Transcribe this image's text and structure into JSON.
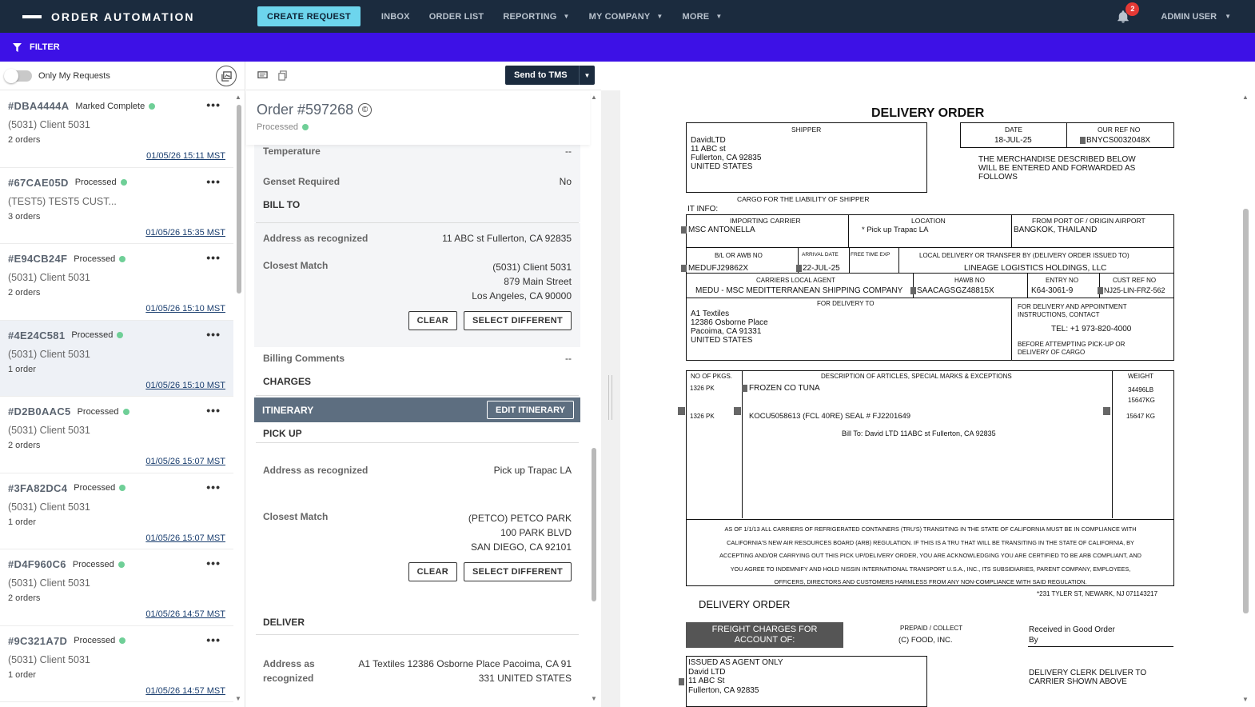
{
  "nav": {
    "brand": "ORDER AUTOMATION",
    "create_request": "CREATE REQUEST",
    "items": [
      "INBOX",
      "ORDER LIST",
      "REPORTING",
      "MY COMPANY",
      "MORE"
    ],
    "notification_count": "2",
    "user": "ADMIN USER"
  },
  "filter": {
    "label": "FILTER"
  },
  "left": {
    "only_my_requests": "Only My Requests",
    "requests": [
      {
        "id": "#DBA4444A",
        "status": "Marked Complete",
        "client": "(5031) Client 5031",
        "orders": "2 orders",
        "time": "01/05/26 15:11 MST"
      },
      {
        "id": "#67CAE05D",
        "status": "Processed",
        "client": "(TEST5) TEST5 CUST...",
        "orders": "3 orders",
        "time": "01/05/26 15:35 MST"
      },
      {
        "id": "#E94CB24F",
        "status": "Processed",
        "client": "(5031) Client 5031",
        "orders": "2 orders",
        "time": "01/05/26 15:10 MST"
      },
      {
        "id": "#4E24C581",
        "status": "Processed",
        "client": "(5031) Client 5031",
        "orders": "1 order",
        "time": "01/05/26 15:10 MST"
      },
      {
        "id": "#D2B0AAC5",
        "status": "Processed",
        "client": "(5031) Client 5031",
        "orders": "2 orders",
        "time": "01/05/26 15:07 MST"
      },
      {
        "id": "#3FA82DC4",
        "status": "Processed",
        "client": "(5031) Client 5031",
        "orders": "1 order",
        "time": "01/05/26 15:07 MST"
      },
      {
        "id": "#D4F960C6",
        "status": "Processed",
        "client": "(5031) Client 5031",
        "orders": "2 orders",
        "time": "01/05/26 14:57 MST"
      },
      {
        "id": "#9C321A7D",
        "status": "Processed",
        "client": "(5031) Client 5031",
        "orders": "1 order",
        "time": "01/05/26 14:57 MST"
      }
    ]
  },
  "mid": {
    "send_to_tms": "Send to TMS",
    "order_title": "Order #597268",
    "order_status": "Processed",
    "temperature_label": "Temperature",
    "temperature_value": "--",
    "genset_label": "Genset Required",
    "genset_value": "No",
    "bill_to_title": "BILL TO",
    "bill_addr_label": "Address as recognized",
    "bill_addr_value": "11 ABC st Fullerton, CA 92835",
    "bill_match_label": "Closest Match",
    "bill_match_lines": [
      "(5031) Client 5031",
      "879 Main Street",
      "Los Angeles, CA 90000"
    ],
    "clear": "CLEAR",
    "select_different": "SELECT DIFFERENT",
    "billing_comments_label": "Billing Comments",
    "billing_comments_value": "--",
    "charges_title": "CHARGES",
    "itinerary_title": "ITINERARY",
    "edit_itinerary": "EDIT ITINERARY",
    "pickup_title": "PICK UP",
    "pickup_addr_label": "Address as recognized",
    "pickup_addr_value": "Pick up Trapac LA",
    "pickup_match_label": "Closest Match",
    "pickup_match_lines": [
      "(PETCO) PETCO PARK",
      "100 PARK BLVD",
      "SAN DIEGO, CA 92101"
    ],
    "deliver_title": "DELIVER",
    "deliver_addr_label_1": "Address as",
    "deliver_addr_label_2": "recognized",
    "deliver_addr_line_1": "A1 Textiles 12386 Osborne Place Pacoima, CA 91",
    "deliver_addr_line_2": "331 UNITED STATES"
  },
  "doc": {
    "title": "DELIVERY ORDER",
    "shipper_cap": "SHIPPER",
    "shipper_lines": [
      "DavidLTD",
      "11 ABC st",
      "Fullerton, CA 92835",
      "UNITED STATES"
    ],
    "date_cap": "DATE",
    "date_val": "18-JUL-25",
    "ref_cap": "OUR REF NO",
    "ref_val": "BNYCS0032048X",
    "merch_lines": [
      "THE MERCHANDISE DESCRIBED BELOW",
      "WILL BE ENTERED AND FORWARDED AS",
      "FOLLOWS"
    ],
    "cargo_liab": "CARGO FOR THE LIABILITY OF SHIPPER",
    "it_info": "IT INFO:",
    "carrier_cap": "IMPORTING CARRIER",
    "carrier_val": "MSC ANTONELLA",
    "location_cap": "LOCATION",
    "location_val": "* Pick up  Trapac LA",
    "port_cap": "FROM PORT OF / ORIGIN AIRPORT",
    "port_val": "BANGKOK, THAILAND",
    "bl_cap": "B/L OR AWB NO",
    "bl_val": "MEDUFJ29862X",
    "arrival_cap": "ARRIVAL DATE",
    "arrival_val": "22-JUL-25",
    "free_cap": "FREE TIME EXP",
    "local_cap": "LOCAL DELIVERY OR TRANSFER BY (DELIVERY ORDER ISSUED TO)",
    "local_val": "LINEAGE LOGISTICS HOLDINGS, LLC",
    "agent_cap": "CARRIERS LOCAL AGENT",
    "agent_val": "MEDU - MSC MEDITTERRANEAN SHIPPING COMPANY",
    "hawb_cap": "HAWB NO",
    "hawb_val": "SAACAGSGZ48815X",
    "entry_cap": "ENTRY NO",
    "entry_val": "K64-3061-9",
    "cust_cap": "CUST REF NO",
    "cust_val": "NJ25-LIN-FRZ-562",
    "for_delivery_cap": "FOR DELIVERY TO",
    "delivery_lines": [
      "A1 Textiles",
      "12386 Osborne Place",
      "Pacoima, CA 91331",
      "UNITED STATES"
    ],
    "appt_lines": [
      "FOR DELIVERY AND APPOINTMENT",
      "INSTRUCTIONS, CONTACT"
    ],
    "tel": "TEL: +1 973-820-4000",
    "before_lines": [
      "BEFORE ATTEMPTING PICK-UP OR",
      "DELIVERY OF CARGO"
    ],
    "pkgs_cap": "NO OF PKGS.",
    "desc_cap": "DESCRIPTION OF ARTICLES, SPECIAL MARKS & EXCEPTIONS",
    "weight_cap": "WEIGHT",
    "pkgs_1": "1326 PK",
    "desc_1": "FROZEN CO TUNA",
    "weight_1a": "34496LB",
    "weight_1b": "15647KG",
    "pkgs_2": "1326 PK",
    "desc_2": "KOCU5058613  (FCL 40RE) SEAL # FJ2201649",
    "weight_2": "15647 KG",
    "bill_to_line": "Bill To: David LTD 11ABC st Fullerton, CA 92835",
    "legal_lines": [
      "AS OF 1/1/13 ALL CARRIERS OF REFRIGERATED CONTAINERS (TRU'S) TRANSITING IN THE STATE OF CALIFORNIA MUST BE IN COMPLIANCE WITH",
      "CALIFORNIA'S NEW AIR RESOURCES BOARD (ARB) REGULATION.  IF THIS IS A TRU THAT WILL BE TRANSITING IN THE STATE OF CALIFORNIA, BY",
      "ACCEPTING AND/OR CARRYING OUT THIS PICK UP/DELIVERY ORDER, YOU ARE ACKNOWLEDGING YOU ARE CERTIFIED TO BE ARB COMPLIANT, AND",
      "YOU AGREE TO INDEMNIFY AND HOLD NISSIN INTERNATIONAL TRANSPORT U.S.A., INC., ITS SUBSIDIARIES, PARENT COMPANY, EMPLOYEES,",
      "OFFICERS, DIRECTORS AND CUSTOMERS HARMLESS FROM ANY NON-COMPLIANCE WITH SAID REGULATION."
    ],
    "address_footer": "*231 TYLER ST, NEWARK, NJ 071143217",
    "do_footer": "DELIVERY ORDER",
    "freight_lines": [
      "FREIGHT CHARGES FOR",
      "ACCOUNT OF:"
    ],
    "prepaid_cap": "PREPAID / COLLECT",
    "prepaid_val": "(C)  FOOD, INC.",
    "received": "Received in Good Order",
    "by": "By",
    "issued_lines": [
      "ISSUED AS AGENT ONLY",
      "David LTD",
      "11 ABC St",
      "Fullerton, CA 92835"
    ],
    "clerk_lines": [
      "DELIVERY CLERK DELIVER TO",
      "CARRIER SHOWN ABOVE"
    ]
  }
}
